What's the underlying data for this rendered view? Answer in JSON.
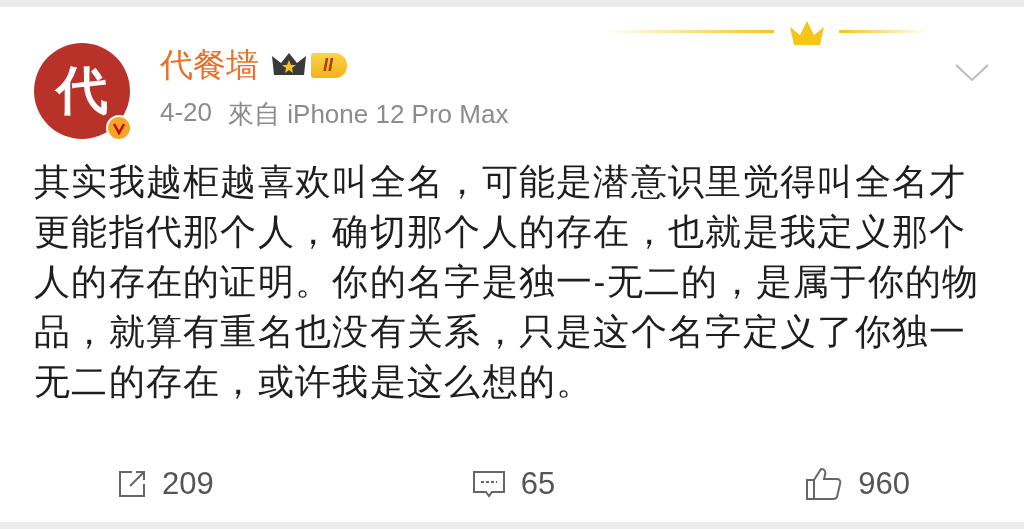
{
  "post": {
    "avatar_text": "代",
    "verified": true,
    "username": "代餐墙",
    "level_badge": "II",
    "date": "4-20",
    "source": "來自 iPhone 12 Pro Max",
    "text": "其实我越柜越喜欢叫全名，可能是潜意识里觉得叫全名才更能指代那个人，确切那个人的存在，也就是我定义那个人的存在的证明。你的名字是独一-无二的，是属于你的物品，就算有重名也没有关系，只是这个名字定义了你独一无二的存在，或许我是这么想的。"
  },
  "actions": [
    {
      "kind": "repost",
      "count": "209"
    },
    {
      "kind": "comment",
      "count": "65"
    },
    {
      "kind": "like",
      "count": "960"
    }
  ]
}
